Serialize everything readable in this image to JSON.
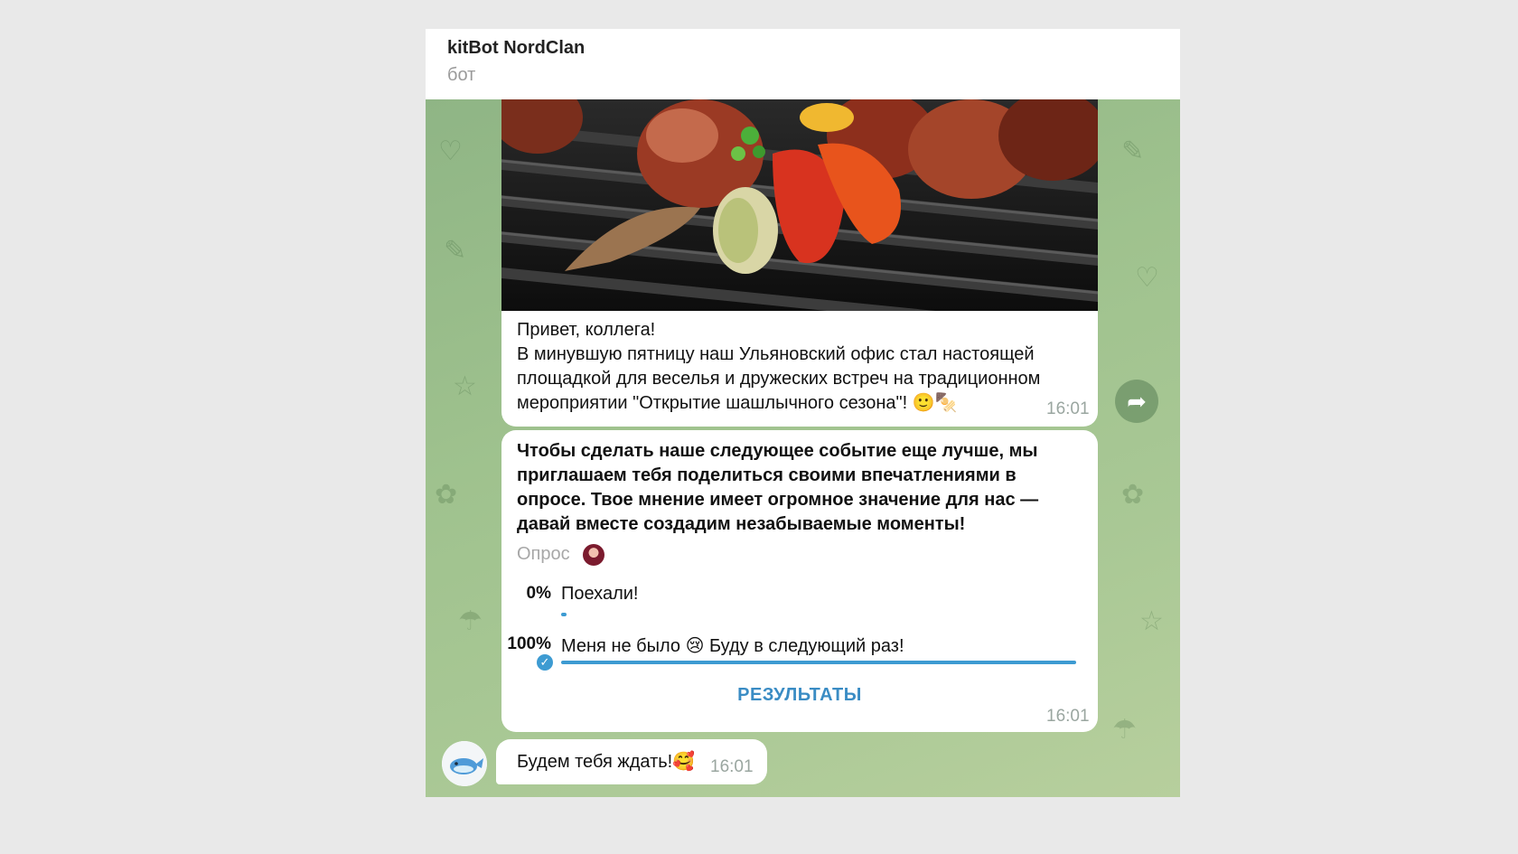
{
  "header": {
    "title": "kitBot NordClan",
    "subtitle": "бот"
  },
  "messages": {
    "post": {
      "text": "Привет, коллега!\nВ минувшую пятницу наш Ульяновский офис стал настоящей площадкой для веселья и дружеских встреч на традиционном мероприятии \"Открытие шашлычного сезона\"! 🙂🍢",
      "time": "16:01"
    },
    "poll": {
      "question": "Чтобы сделать наше следующее событие еще лучше, мы приглашаем тебя поделиться своими впечатлениями в опросе. Твое мнение имеет огромное значение для нас — давай вместе создадим незабываемые моменты!",
      "kind": "Опрос",
      "options": [
        {
          "percent_label": "0%",
          "text": "Поехали!",
          "fraction": 0.0
        },
        {
          "percent_label": "100%",
          "text": "Меня не было 😢 Буду в следующий раз!",
          "fraction": 1.0,
          "selected": true
        }
      ],
      "results_label": "РЕЗУЛЬТАТЫ",
      "time": "16:01"
    },
    "reply": {
      "text": "Будем тебя ждать!🥰",
      "time": "16:01"
    }
  },
  "colors": {
    "accent": "#3d9bd2",
    "chat_background": "#9fc28e"
  },
  "icons": {
    "share": "share-arrow-icon",
    "check": "checkmark-icon"
  }
}
